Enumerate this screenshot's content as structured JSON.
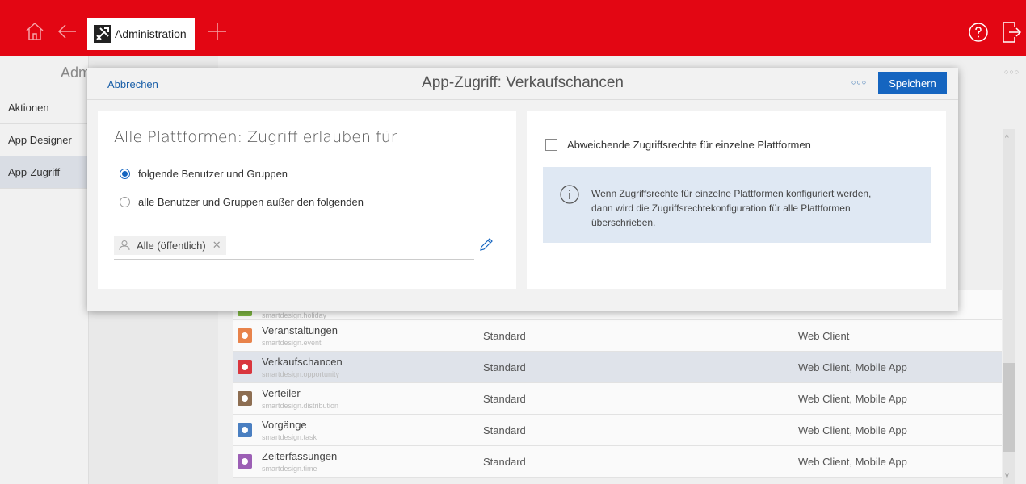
{
  "topbar": {
    "tab_label": "Administration"
  },
  "sidebar": {
    "title": "Adm",
    "items": [
      {
        "label": "Aktionen"
      },
      {
        "label": "App Designer"
      },
      {
        "label": "App-Zugriff"
      }
    ]
  },
  "table": {
    "rows": [
      {
        "name": "Veranstaltungen",
        "id": "smartdesign.event",
        "type": "Standard",
        "platforms": "Web Client",
        "icon": "calendar-icon",
        "color": "#e8834b"
      },
      {
        "name": "Verkaufschancen",
        "id": "smartdesign.opportunity",
        "type": "Standard",
        "platforms": "Web Client, Mobile App",
        "icon": "opportunity-icon",
        "color": "#d9363e"
      },
      {
        "name": "Verteiler",
        "id": "smartdesign.distribution",
        "type": "Standard",
        "platforms": "Web Client, Mobile App",
        "icon": "distribution-icon",
        "color": "#8d6e52"
      },
      {
        "name": "Vorgänge",
        "id": "smartdesign.task",
        "type": "Standard",
        "platforms": "Web Client, Mobile App",
        "icon": "task-icon",
        "color": "#4a7fc1"
      },
      {
        "name": "Zeiterfassungen",
        "id": "smartdesign.time",
        "type": "Standard",
        "platforms": "Web Client, Mobile App",
        "icon": "time-icon",
        "color": "#9c5fb5"
      }
    ],
    "partial_row_id": "smartdesign.holiday"
  },
  "modal": {
    "cancel_label": "Abbrechen",
    "title": "App-Zugriff: Verkaufschancen",
    "save_label": "Speichern",
    "left": {
      "title": "Alle Plattformen: Zugriff erlauben für",
      "option_include": "folgende Benutzer und Gruppen",
      "option_exclude": "alle Benutzer und Gruppen außer den folgenden",
      "selected_option": "include",
      "chip_label": "Alle (öffentlich)"
    },
    "right": {
      "checkbox_label": "Abweichende Zugriffsrechte für einzelne Plattformen",
      "checkbox_checked": false,
      "info_text": "Wenn Zugriffsrechte für einzelne Plattformen konfiguriert werden,\ndann wird die Zugriffsrechtekonfiguration für alle Plattformen\nüberschrieben."
    }
  },
  "colors": {
    "brand_red": "#e30613",
    "accent_blue": "#1565c0",
    "info_bg": "#dfe8f3"
  }
}
